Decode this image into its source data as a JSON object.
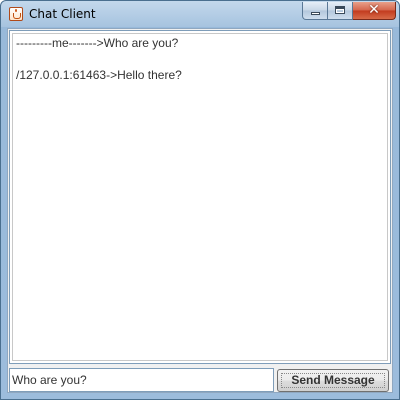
{
  "window": {
    "title": "Chat Client",
    "icon": "java-cup-icon",
    "controls": {
      "minimize_icon": "minimize-icon",
      "maximize_icon": "maximize-icon",
      "close_icon": "close-icon",
      "close_glyph": "✕"
    }
  },
  "chat": {
    "messages": [
      "---------me------->Who are you?",
      "/127.0.0.1:61463->Hello there?"
    ]
  },
  "composer": {
    "input_value": "Who are you?",
    "send_label": "Send Message"
  },
  "colors": {
    "title_bar": "#a6c3df",
    "close_button": "#c23a1e",
    "text": "#333333"
  }
}
